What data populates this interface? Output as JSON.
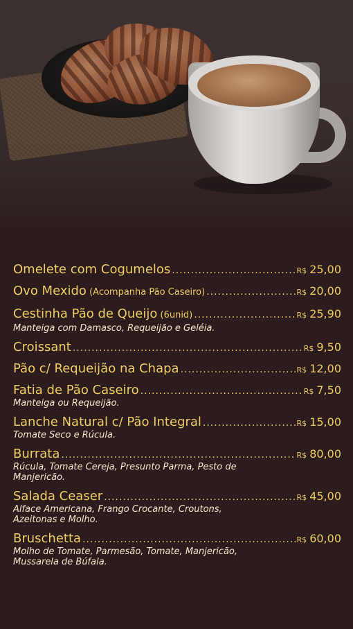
{
  "menu": {
    "currency": "R$",
    "items": [
      {
        "name": "Omelete com Cogumelos",
        "note": "",
        "price": "25,00",
        "desc": ""
      },
      {
        "name": "Ovo Mexido",
        "note": "(Acompanha Pão Caseiro)",
        "price": "20,00",
        "desc": ""
      },
      {
        "name": "Cestinha Pão de Queijo",
        "note": "(6unid)",
        "price": "25,90",
        "desc": "Manteiga com Damasco, Requeijão e Geléia."
      },
      {
        "name": "Croissant",
        "note": "",
        "price": "9,50",
        "desc": ""
      },
      {
        "name": "Pão c/ Requeijão na Chapa",
        "note": "",
        "price": "12,00",
        "desc": ""
      },
      {
        "name": "Fatia de Pão Caseiro",
        "note": "",
        "price": "7,50",
        "desc": "Manteiga ou Requeijão."
      },
      {
        "name": "Lanche Natural c/ Pão Integral",
        "note": "",
        "price": "15,00",
        "desc": "Tomate Seco e Rúcula."
      },
      {
        "name": "Burrata",
        "note": "",
        "price": "80,00",
        "desc": "Rúcula, Tomate Cereja, Presunto Parma, Pesto de Manjericão."
      },
      {
        "name": "Salada Ceaser",
        "note": "",
        "price": "45,00",
        "desc": "Alface Americana, Frango Crocante, Croutons, Azeitonas e Molho."
      },
      {
        "name": "Bruschetta",
        "note": "",
        "price": "60,00",
        "desc": "Molho de Tomate, Parmesão, Tomate, Manjericão, Mussarela de Búfala."
      }
    ]
  }
}
